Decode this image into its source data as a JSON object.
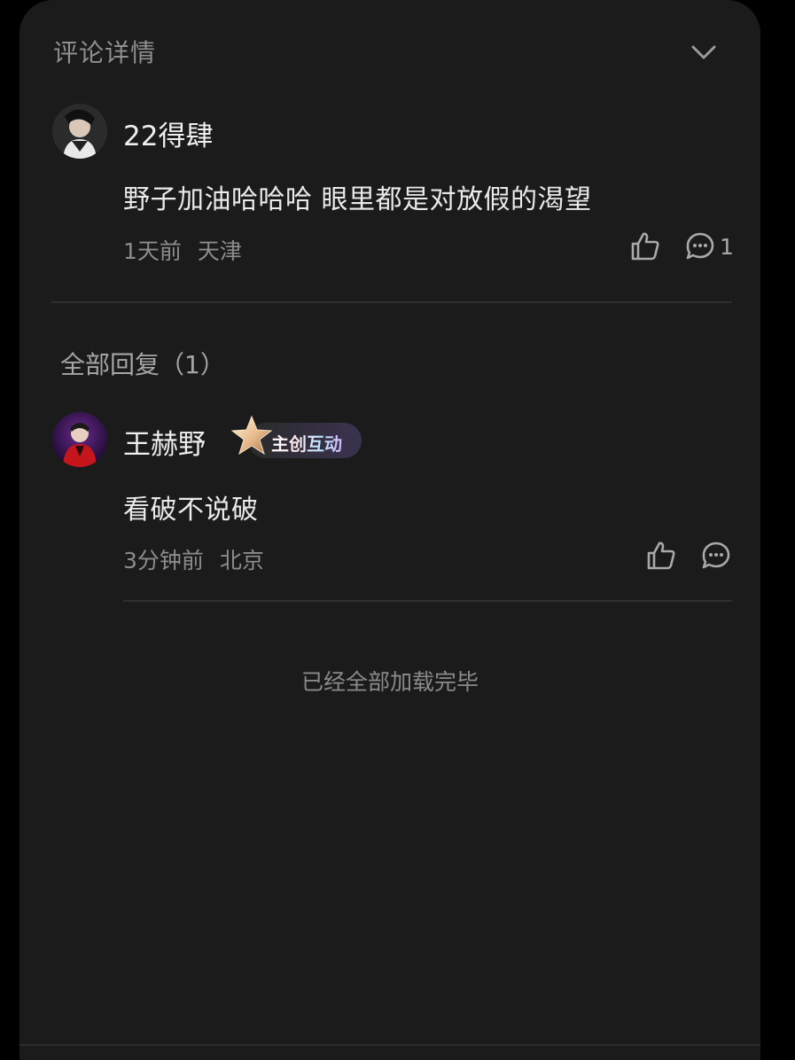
{
  "header": {
    "title": "评论详情"
  },
  "comment": {
    "user": "22得肆",
    "text": "野子加油哈哈哈 眼里都是对放假的渴望",
    "time": "1天前",
    "location": "天津",
    "reply_count": "1"
  },
  "replies_section": {
    "title": "全部回复（1）"
  },
  "replies": [
    {
      "user": "王赫野",
      "badge": "主创互动",
      "text": "看破不说破",
      "time": "3分钟前",
      "location": "北京"
    }
  ],
  "footer": {
    "end_text": "已经全部加载完毕"
  },
  "colors": {
    "background": "#1b1b1b",
    "text_primary": "#efefef",
    "text_secondary": "#8c8c8c",
    "badge_gradient": [
      "#ffe8ef",
      "#b9e4ff",
      "#d3b8ff"
    ]
  },
  "icons": [
    "chevron-down-icon",
    "thumbs-up-icon",
    "comment-bubble-icon",
    "star-badge-icon"
  ]
}
